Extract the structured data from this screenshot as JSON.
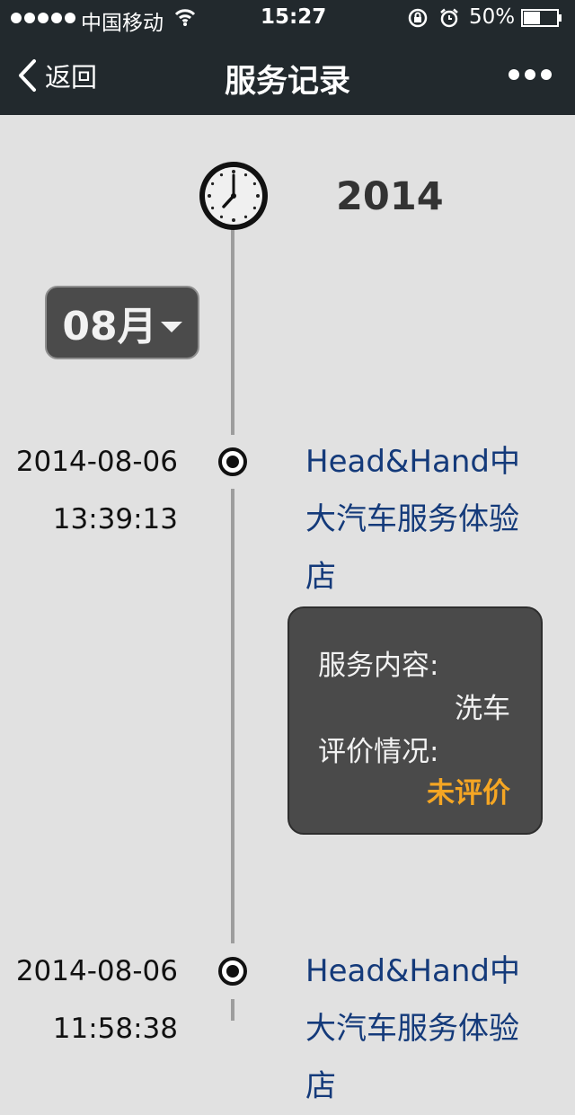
{
  "status_bar": {
    "carrier": "中国移动",
    "time": "15:27",
    "battery_percent": "50%",
    "battery_level": 0.5,
    "signal_dots": 5
  },
  "nav": {
    "back_label": "返回",
    "title": "服务记录",
    "more_icon": "ellipsis-icon"
  },
  "timeline": {
    "year": "2014",
    "month_label": "08月",
    "records": [
      {
        "date": "2014-08-06",
        "time": "13:39:13",
        "store": "Head&Hand中大汽车服务体验店",
        "service_label": "服务内容:",
        "service_value": "洗车",
        "review_label": "评价情况:",
        "review_value": "未评价"
      },
      {
        "date": "2014-08-06",
        "time": "11:58:38",
        "store": "Head&Hand中大汽车服务体验店"
      }
    ]
  },
  "colors": {
    "nav_background": "#22292d",
    "page_background": "#e1e1e1",
    "store_link": "#143a7a",
    "card_background": "#4a4a4a",
    "review_pending": "#f5a623"
  }
}
